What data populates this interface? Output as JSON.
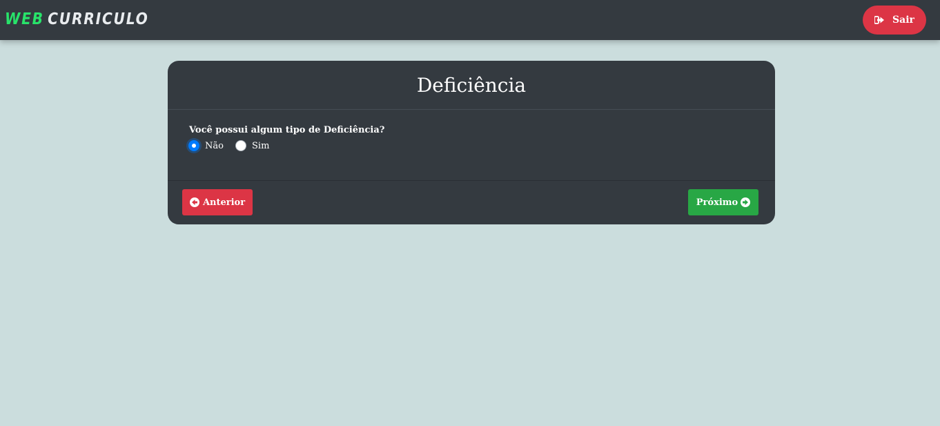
{
  "navbar": {
    "brand_part1": "WEB",
    "brand_part2": "CURRICULO",
    "logout_label": "Sair",
    "logout_icon": "sign-out-icon"
  },
  "card": {
    "title": "Deficiência",
    "question": "Você possui algum tipo de Deficiência?",
    "options": [
      {
        "label": "Não",
        "selected": true
      },
      {
        "label": "Sim",
        "selected": false
      }
    ],
    "prev_label": "Anterior",
    "next_label": "Próximo"
  },
  "colors": {
    "background": "#cbdddd",
    "navbar": "#343a40",
    "brand_accent": "#28e36a",
    "danger": "#dc3545",
    "success": "#28a745",
    "radio_checked": "#007bff"
  }
}
